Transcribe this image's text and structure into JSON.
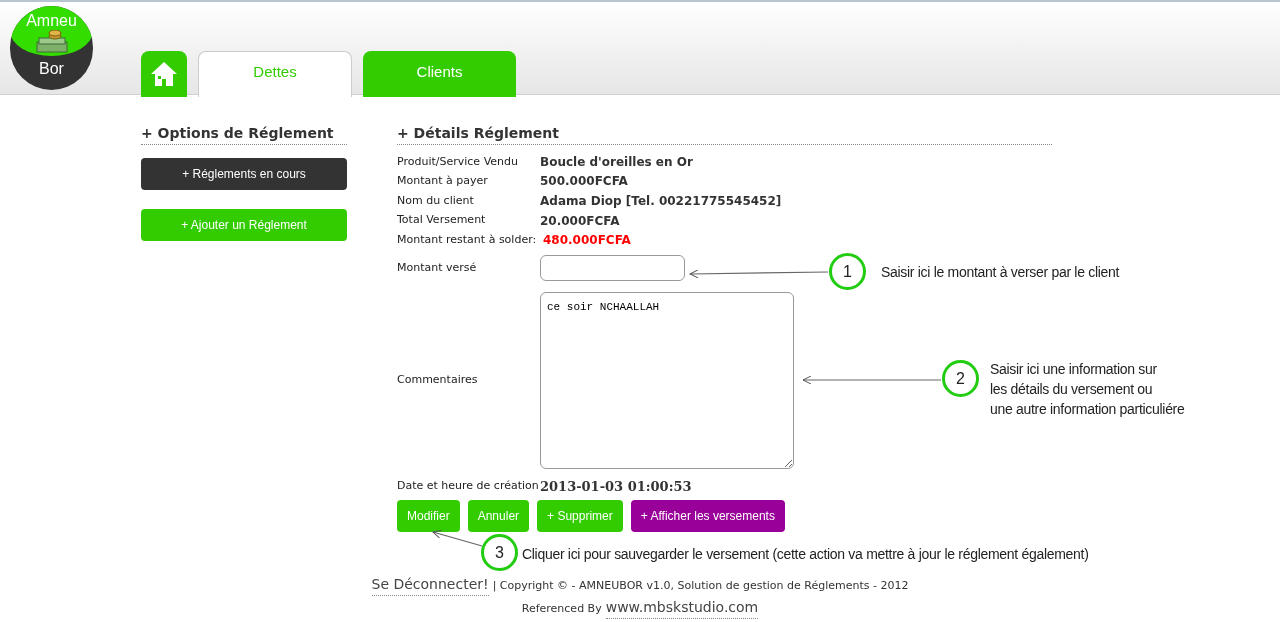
{
  "logo": {
    "top": "Amneu",
    "bottom": "Bor"
  },
  "tabs": [
    {
      "kind": "home",
      "selected": false
    },
    {
      "kind": "text",
      "label": "Dettes",
      "selected": true
    },
    {
      "kind": "text",
      "label": "Clients",
      "selected": false
    }
  ],
  "sidebar": {
    "title": "+ Options de Réglement",
    "buttons": [
      {
        "label": "+ Réglements en cours",
        "kind": "dark"
      },
      {
        "label": "+ Ajouter un Réglement",
        "kind": "green"
      }
    ]
  },
  "details": {
    "title": "+ Détails Réglement",
    "fields": [
      {
        "label": "Produit/Service Vendu",
        "value": "Boucle d'oreilles en Or",
        "kind": "normal"
      },
      {
        "label": "Montant à payer",
        "value": "500.000FCFA",
        "kind": "normal"
      },
      {
        "label": "Nom du client",
        "value": "Adama Diop [Tel. 00221775545452]",
        "kind": "normal"
      },
      {
        "label": "Total Versement",
        "value": "20.000FCFA",
        "kind": "normal"
      },
      {
        "label": "Montant restant à solder:",
        "value": "480.000FCFA",
        "kind": "alert"
      }
    ],
    "amount": {
      "label": "Montant versé"
    },
    "comments": {
      "label": "Commentaires",
      "value": "ce soir NCHAALLAH"
    },
    "created": {
      "label": "Date et heure de création",
      "value": "2013-01-03 01:00:53"
    },
    "buttons": [
      {
        "label": "Modifier",
        "kind": "green"
      },
      {
        "label": "Annuler",
        "kind": "green"
      },
      {
        "label": "+ Supprimer",
        "kind": "green"
      },
      {
        "label": "+ Afficher les versements",
        "kind": "purple"
      }
    ]
  },
  "annotations": [
    {
      "number": "1",
      "lines": [
        "Saisir ici le montant à verser par le client"
      ]
    },
    {
      "number": "2",
      "lines": [
        "Saisir ici une information sur",
        "les détails du versement ou",
        "une autre information particuliére"
      ]
    },
    {
      "number": "3",
      "lines": [
        "Cliquer ici pour sauvegarder le versement (cette action va mettre à jour le réglement également)"
      ]
    }
  ],
  "footer": {
    "logout": "Se Déconnecter!",
    "copyright": "| Copyright © - AMNEUBOR v1.0, Solution de gestion de Réglements - 2012",
    "referenced": "Referenced By",
    "website": "www.mbskstudio.com"
  }
}
